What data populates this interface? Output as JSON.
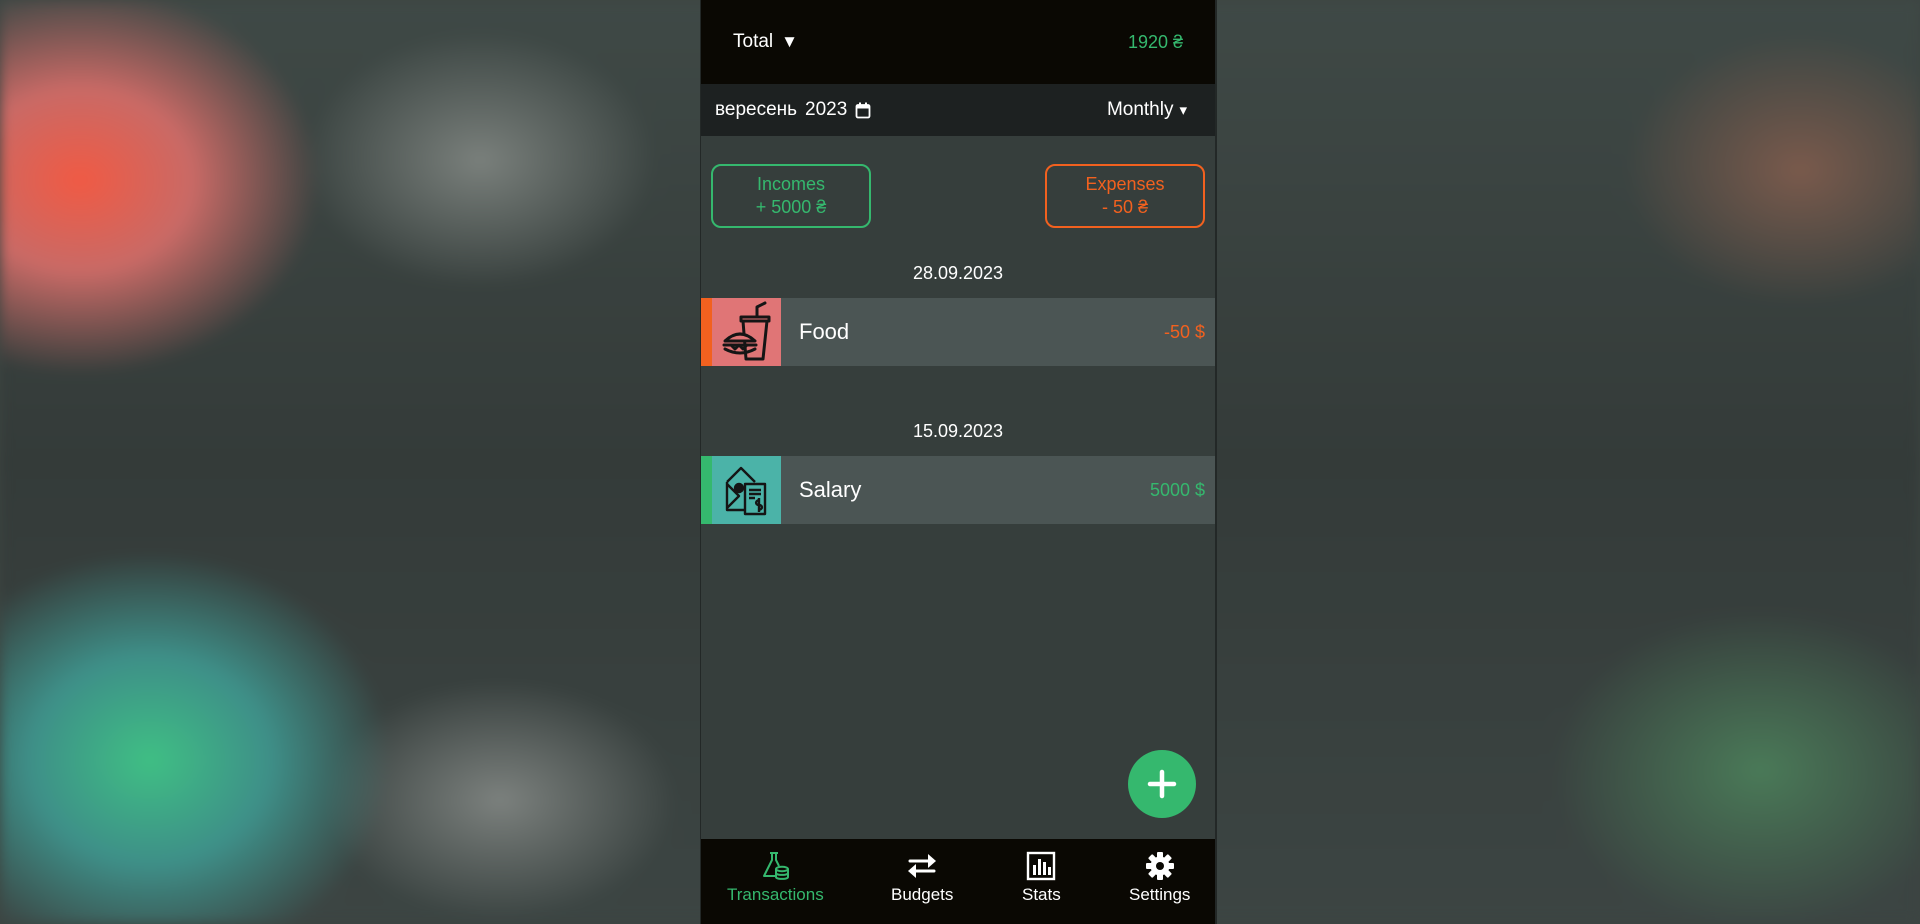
{
  "header": {
    "account_label": "Total",
    "account_caret": "▼",
    "balance": "1920 ₴"
  },
  "period_bar": {
    "month": "вересень",
    "year": "2023",
    "period": "Monthly",
    "period_caret": "▾"
  },
  "summary": {
    "incomes_label": "Incomes",
    "incomes_value": "+ 5000 ₴",
    "expenses_label": "Expenses",
    "expenses_value": "- 50 ₴"
  },
  "transactions": [
    {
      "date": "28.09.2023",
      "name": "Food",
      "amount": "-50 $",
      "icon": "fast-food-icon",
      "stripe_color": "#f2611f",
      "icon_bg": "#e07576",
      "amount_color": "#f2611f"
    },
    {
      "date": "15.09.2023",
      "name": "Salary",
      "amount": "5000 $",
      "icon": "salary-envelope-icon",
      "stripe_color": "#35b86e",
      "icon_bg": "#4bb3a8",
      "amount_color": "#35b86e"
    }
  ],
  "fab": {
    "icon": "plus-icon"
  },
  "nav": [
    {
      "label": "Transactions",
      "icon": "flask-coins-icon",
      "active": true
    },
    {
      "label": "Budgets",
      "icon": "transfer-arrows-icon",
      "active": false
    },
    {
      "label": "Stats",
      "icon": "bar-chart-icon",
      "active": false
    },
    {
      "label": "Settings",
      "icon": "gear-icon",
      "active": false
    }
  ],
  "colors": {
    "accent_green": "#35b86e",
    "accent_orange": "#f2611f",
    "bar_black": "#0a0803",
    "panel": "#363e3c",
    "row": "#4b5554"
  }
}
